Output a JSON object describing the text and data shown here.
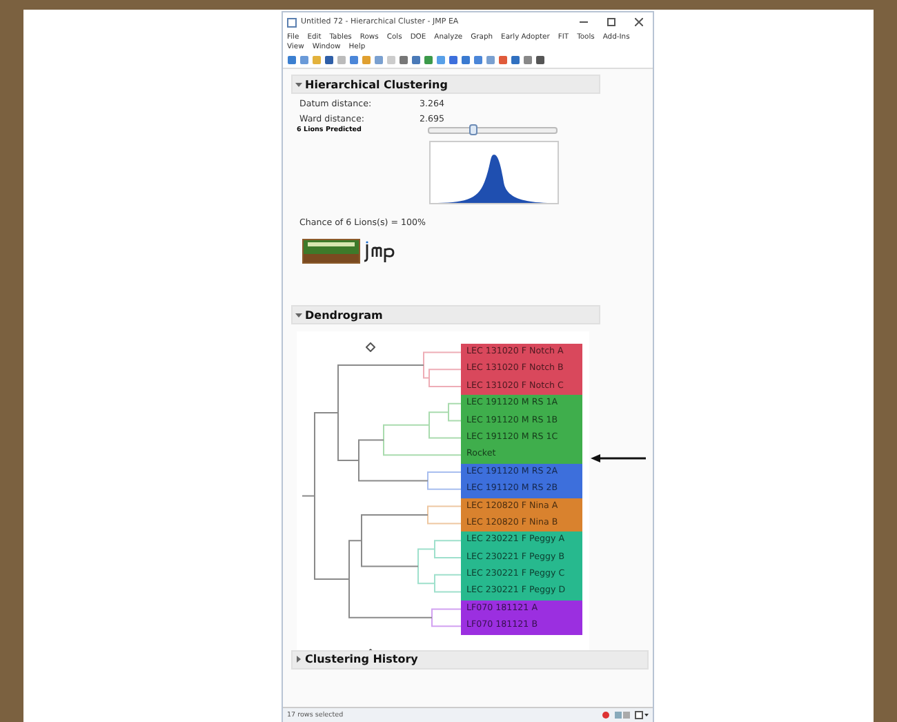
{
  "window": {
    "title": "Untitled 72 - Hierarchical Cluster - JMP EA"
  },
  "menu": [
    "File",
    "Edit",
    "Tables",
    "Rows",
    "Cols",
    "DOE",
    "Analyze",
    "Graph",
    "Early Adopter",
    "FIT",
    "Tools",
    "Add-Ins",
    "View",
    "Window",
    "Help"
  ],
  "clustering": {
    "title": "Hierarchical Clustering",
    "expanded": true,
    "stats": [
      {
        "label": "Datum distance:",
        "value": "3.264"
      },
      {
        "label": "Ward distance:",
        "value": "2.695"
      }
    ],
    "predicted_label": "6 Lions Predicted",
    "slider": {
      "level": 0.35
    },
    "chance": "Chance of 6 Lions(s)  =  100%"
  },
  "dendrogram": {
    "title": "Dendrogram",
    "expanded": true,
    "leaves": [
      {
        "label": "LEC 131020 F Notch A",
        "color": "#d9485c"
      },
      {
        "label": "LEC 131020 F Notch B",
        "color": "#d9485c"
      },
      {
        "label": "LEC 131020 F Notch C",
        "color": "#d9485c"
      },
      {
        "label": "LEC 191120 M RS 1A",
        "color": "#3fae4c"
      },
      {
        "label": "LEC 191120 M RS 1B",
        "color": "#3fae4c"
      },
      {
        "label": "LEC 191120 M RS 1C",
        "color": "#3fae4c"
      },
      {
        "label": "Rocket",
        "color": "#3fae4c"
      },
      {
        "label": "LEC 191120 M RS 2A",
        "color": "#3d6fdc"
      },
      {
        "label": "LEC 191120 M RS 2B",
        "color": "#3d6fdc"
      },
      {
        "label": "LEC 120820 F Nina A",
        "color": "#d9822e"
      },
      {
        "label": "LEC 120820 F Nina B",
        "color": "#d9822e"
      },
      {
        "label": "LEC 230221 F Peggy A",
        "color": "#27b98e"
      },
      {
        "label": "LEC 230221 F Peggy B",
        "color": "#27b98e"
      },
      {
        "label": "LEC 230221 F Peggy C",
        "color": "#27b98e"
      },
      {
        "label": "LEC 230221 F Peggy D",
        "color": "#27b98e"
      },
      {
        "label": "LF070 181121 A",
        "color": "#9b2fe0"
      },
      {
        "label": "LF070 181121 B",
        "color": "#9b2fe0"
      }
    ]
  },
  "history": {
    "title": "Clustering History",
    "expanded": false
  },
  "status_bar": {
    "text": "17 rows selected"
  }
}
